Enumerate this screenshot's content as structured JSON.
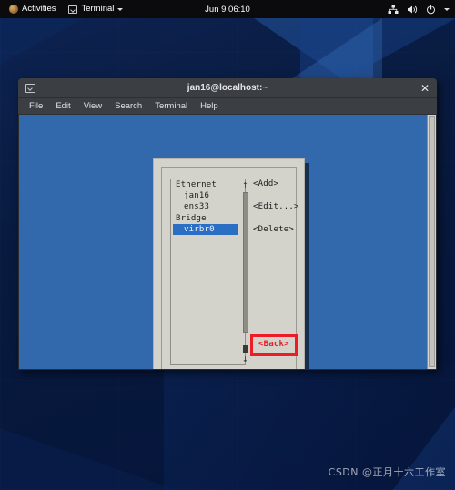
{
  "topbar": {
    "activities_label": "Activities",
    "app_menu_label": "Terminal",
    "clock": "Jun 9 06:10",
    "icons": {
      "gnome_logo": "gnome-footprint-icon",
      "terminal": "terminal-icon",
      "app_caret": "chevron-down-icon",
      "network": "network-wired-icon",
      "volume": "volume-icon",
      "power": "power-icon",
      "system_caret": "chevron-down-icon"
    }
  },
  "window": {
    "title": "jan16@localhost:~",
    "close_label": "✕",
    "menu": [
      "File",
      "Edit",
      "View",
      "Search",
      "Terminal",
      "Help"
    ],
    "terminal_bg": "#3269ad"
  },
  "dialog": {
    "list": [
      {
        "label": "Ethernet",
        "type": "group",
        "selected": false
      },
      {
        "label": "jan16",
        "type": "item",
        "selected": false
      },
      {
        "label": "ens33",
        "type": "item",
        "selected": false
      },
      {
        "label": "Bridge",
        "type": "group",
        "selected": false
      },
      {
        "label": "virbr0",
        "type": "item",
        "selected": true
      }
    ],
    "scroll_up": "↑",
    "scroll_down": "↓",
    "buttons": [
      "<Add>",
      "<Edit...>",
      "<Delete>"
    ],
    "back_button": "<Back>",
    "highlight_color": "#ee1c25",
    "selection_color": "#2b6fc4"
  },
  "watermark": {
    "text": "CSDN @正月十六工作室"
  }
}
